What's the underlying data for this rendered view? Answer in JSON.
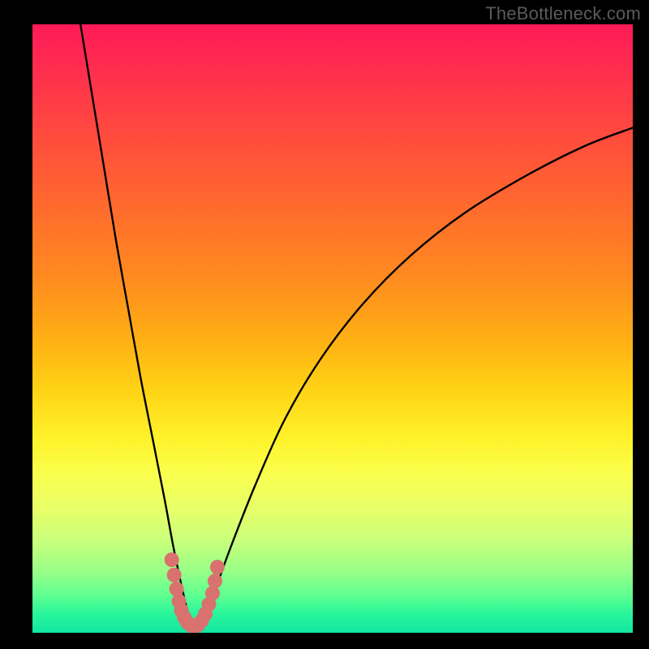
{
  "watermark": "TheBottleneck.com",
  "chart_data": {
    "type": "line",
    "title": "",
    "xlabel": "",
    "ylabel": "",
    "xlim": [
      0,
      100
    ],
    "ylim": [
      0,
      100
    ],
    "background_gradient": {
      "top": "#ff1a58",
      "middle": "#ffd315",
      "bottom": "#12e6a2"
    },
    "series": [
      {
        "name": "bottleneck-curve",
        "color": "#000000",
        "x": [
          8,
          10,
          12,
          14,
          16,
          18,
          20,
          22,
          23.5,
          25,
          26,
          27,
          28,
          30,
          33,
          37,
          42,
          48,
          55,
          63,
          72,
          82,
          92,
          100
        ],
        "values": [
          100,
          88,
          76,
          64,
          53,
          42,
          32,
          22,
          14,
          7,
          3,
          1,
          2,
          6,
          14,
          24,
          35,
          45,
          54,
          62,
          69,
          75,
          80,
          83
        ]
      }
    ],
    "markers": {
      "name": "highlighted-range",
      "color": "#d9716f",
      "points": [
        {
          "x": 23.2,
          "y": 12.0
        },
        {
          "x": 23.6,
          "y": 9.5
        },
        {
          "x": 24.0,
          "y": 7.2
        },
        {
          "x": 24.4,
          "y": 5.2
        },
        {
          "x": 24.8,
          "y": 3.7
        },
        {
          "x": 25.3,
          "y": 2.5
        },
        {
          "x": 25.8,
          "y": 1.7
        },
        {
          "x": 26.4,
          "y": 1.2
        },
        {
          "x": 27.0,
          "y": 1.0
        },
        {
          "x": 27.6,
          "y": 1.3
        },
        {
          "x": 28.2,
          "y": 2.0
        },
        {
          "x": 28.8,
          "y": 3.1
        },
        {
          "x": 29.4,
          "y": 4.7
        },
        {
          "x": 30.0,
          "y": 6.5
        },
        {
          "x": 30.4,
          "y": 8.5
        },
        {
          "x": 30.8,
          "y": 10.8
        }
      ]
    }
  }
}
